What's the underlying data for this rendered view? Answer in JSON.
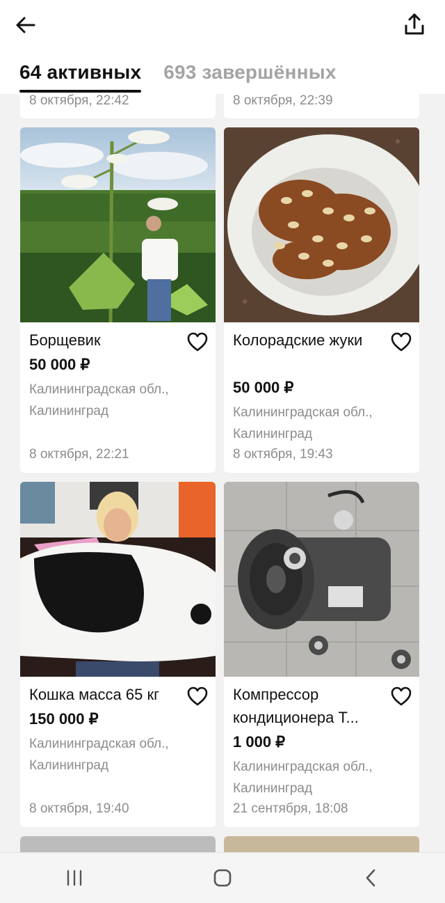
{
  "header": {
    "tabs": [
      {
        "label": "64 активных",
        "active": true
      },
      {
        "label": "693 завершённых",
        "active": false
      }
    ]
  },
  "partial_top": {
    "left_date": "8 октября, 22:42",
    "right_date": "8 октября, 22:39"
  },
  "listings": [
    {
      "title": "Борщевик",
      "price": "50 000 ₽",
      "location": "Калининградская обл., Калининград",
      "date": "8 октября, 22:21"
    },
    {
      "title": "Колорадские жуки",
      "price": "50 000 ₽",
      "location": "Калининградская обл., Калининград",
      "date": "8 октября, 19:43"
    },
    {
      "title": "Кошка масса 65 кг",
      "price": "150 000 ₽",
      "location": "Калининградская обл., Калининград",
      "date": "8 октября, 19:40"
    },
    {
      "title": "Компрессор кондиционера Т...",
      "price": "1 000 ₽",
      "location": "Калининградская обл., Калининград",
      "date": "21 сентября, 18:08"
    }
  ],
  "icons": {
    "back": "arrow-left-icon",
    "share": "share-upload-icon",
    "favorite": "heart-outline-icon",
    "nav": [
      "recent-apps-icon",
      "home-icon",
      "back-chevron-icon"
    ]
  },
  "colors": {
    "text_primary": "#111111",
    "text_secondary": "#8c8c8c",
    "tab_inactive": "#a4a4a4",
    "background": "#f2f2f2"
  }
}
